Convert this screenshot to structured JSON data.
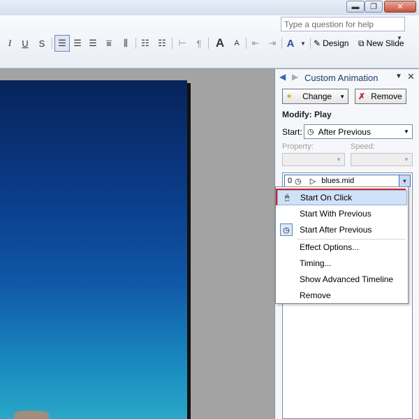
{
  "titlebar": {
    "buttons": [
      "minimize-button",
      "maximize-button",
      "close-button"
    ]
  },
  "toolbar": {
    "ask_placeholder": "Type a question for help",
    "design_label": "Design",
    "new_slide_label": "New Slide"
  },
  "task_pane": {
    "title": "Custom Animation",
    "change_label": "Change",
    "remove_label": "Remove",
    "modify_label": "Modify: Play",
    "start_label": "Start:",
    "start_value": "After Previous",
    "property_label": "Property:",
    "speed_label": "Speed:",
    "animation_item": {
      "order": "0",
      "name": "blues.mid"
    }
  },
  "context_menu": {
    "items": [
      {
        "label": "Start On Click",
        "highlighted": true
      },
      {
        "label": "Start With Previous"
      },
      {
        "label": "Start After Previous",
        "checked": true
      },
      {
        "label": "Effect Options..."
      },
      {
        "label": "Timing..."
      },
      {
        "label": "Show Advanced Timeline"
      },
      {
        "label": "Remove"
      }
    ]
  },
  "colors": {
    "highlight_outline": "#d0202a",
    "slide_top": "#07235b",
    "slide_bottom": "#2aa7c8",
    "menu_highlight": "#cfe2f7"
  }
}
